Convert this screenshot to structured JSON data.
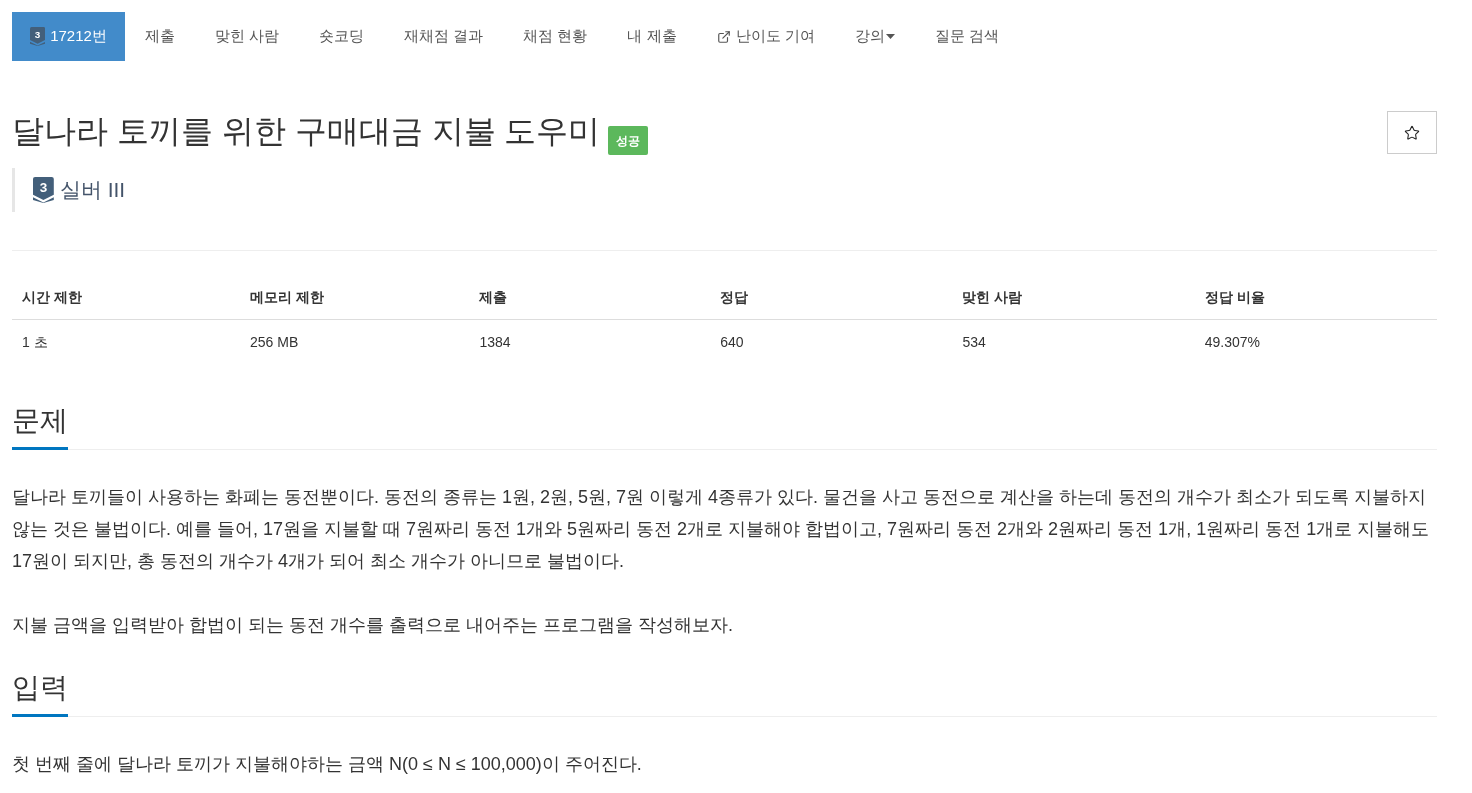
{
  "nav": [
    {
      "kind": "problem",
      "badge": "3",
      "label": "17212번",
      "selected": true
    },
    {
      "kind": "link",
      "label": "제출",
      "selected": false
    },
    {
      "kind": "link",
      "label": "맞힌 사람",
      "selected": false
    },
    {
      "kind": "link",
      "label": "숏코딩",
      "selected": false
    },
    {
      "kind": "link",
      "label": "재채점 결과",
      "selected": false
    },
    {
      "kind": "link",
      "label": "채점 현황",
      "selected": false
    },
    {
      "kind": "link",
      "label": "내 제출",
      "selected": false
    },
    {
      "kind": "external",
      "label": "난이도 기여",
      "selected": false
    },
    {
      "kind": "dropdown",
      "label": "강의",
      "selected": false
    },
    {
      "kind": "link",
      "label": "질문 검색",
      "selected": false
    }
  ],
  "title": "달나라 토끼를 위한 구매대금 지불 도우미",
  "status": {
    "kind": "success",
    "label": "성공"
  },
  "tier": {
    "level": "3",
    "name": "실버 III"
  },
  "stats": {
    "columns": [
      "시간 제한",
      "메모리 제한",
      "제출",
      "정답",
      "맞힌 사람",
      "정답 비율"
    ],
    "rows": [
      [
        "1 초",
        "256 MB",
        "1384",
        "640",
        "534",
        "49.307%"
      ]
    ]
  },
  "sections": [
    {
      "heading": "문제",
      "paragraphs": [
        "달나라 토끼들이 사용하는 화폐는 동전뿐이다. 동전의 종류는 1원, 2원, 5원, 7원 이렇게 4종류가 있다. 물건을 사고 동전으로 계산을 하는데 동전의 개수가 최소가 되도록 지불하지 않는 것은 불법이다. 예를 들어, 17원을 지불할 때 7원짜리 동전 1개와 5원짜리 동전 2개로 지불해야 합법이고, 7원짜리 동전 2개와 2원짜리 동전 1개, 1원짜리 동전 1개로 지불해도 17원이 되지만, 총 동전의 개수가 4개가 되어 최소 개수가 아니므로 불법이다.",
        "지불 금액을 입력받아 합법이 되는 동전 개수를 출력으로 내어주는 프로그램을 작성해보자."
      ]
    },
    {
      "heading": "입력",
      "paragraphs": [
        "첫 번째 줄에 달나라 토끼가 지불해야하는 금액 N(0 ≤ N ≤ 100,000)이 주어진다."
      ]
    }
  ]
}
